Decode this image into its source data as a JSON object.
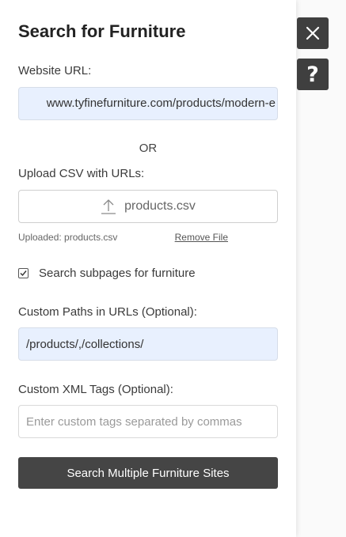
{
  "panel": {
    "title": "Search for Furniture"
  },
  "url_section": {
    "label": "Website URL:",
    "value": "www.tyfinefurniture.com/products/modern-e"
  },
  "divider_text": "OR",
  "csv_section": {
    "label": "Upload CSV with URLs:",
    "file_name": "products.csv",
    "status": "Uploaded: products.csv",
    "remove_label": "Remove File"
  },
  "subpages": {
    "label": "Search subpages for furniture",
    "checked": true
  },
  "custom_paths": {
    "label": "Custom Paths in URLs (Optional):",
    "value": "/products/,/collections/"
  },
  "custom_xml": {
    "label": "Custom XML Tags (Optional):",
    "placeholder": "Enter custom tags separated by commas",
    "value": ""
  },
  "submit_label": "Search Multiple Furniture Sites",
  "side_buttons": {
    "close_icon": "close-icon",
    "help_icon": "question-mark-icon",
    "help_glyph": "?"
  },
  "colors": {
    "button_dark": "#454545",
    "autofill_blue": "#e8f0fe"
  }
}
